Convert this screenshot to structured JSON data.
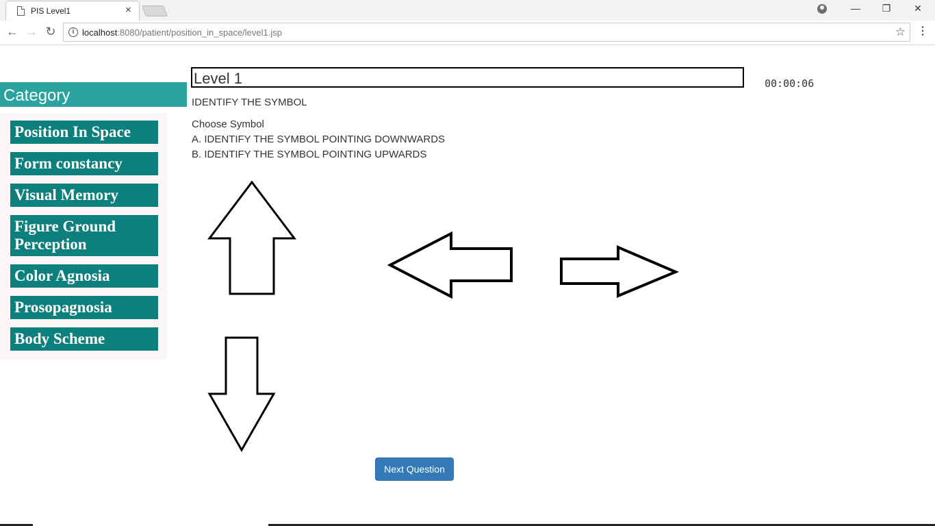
{
  "browser": {
    "tab_title": "PIS Level1",
    "tab_close": "×",
    "url_host": "localhost",
    "url_rest": ":8080/patient/position_in_space/level1.jsp",
    "info_glyph": "i",
    "back_glyph": "←",
    "forward_glyph": "→",
    "reload_glyph": "↻",
    "star_glyph": "☆",
    "menu_glyph": "⋮",
    "minimize_glyph": "—",
    "restore_glyph": "❐",
    "close_glyph": "✕"
  },
  "sidebar": {
    "header": "Category",
    "items": [
      {
        "label": "Position In Space"
      },
      {
        "label": "Form constancy"
      },
      {
        "label": "Visual Memory"
      },
      {
        "label": "Figure Ground Perception"
      },
      {
        "label": "Color Agnosia"
      },
      {
        "label": "Prosopagnosia"
      },
      {
        "label": "Body Scheme"
      }
    ]
  },
  "main": {
    "level_title": "Level 1",
    "timer": "00:00:06",
    "instruction": "IDENTIFY THE SYMBOL",
    "choose": "Choose Symbol",
    "option_a": "A. IDENTIFY THE SYMBOL POINTING DOWNWARDS",
    "option_b": "B. IDENTIFY THE SYMBOL POINTING UPWARDS",
    "next_button": "Next Question"
  },
  "symbols": [
    {
      "name": "arrow-up",
      "direction": "up"
    },
    {
      "name": "arrow-left",
      "direction": "left"
    },
    {
      "name": "arrow-right",
      "direction": "right"
    },
    {
      "name": "arrow-down",
      "direction": "down"
    }
  ],
  "colors": {
    "category_header": "#2aa3a0",
    "category_item": "#0d7f7c",
    "button": "#337ab7"
  }
}
